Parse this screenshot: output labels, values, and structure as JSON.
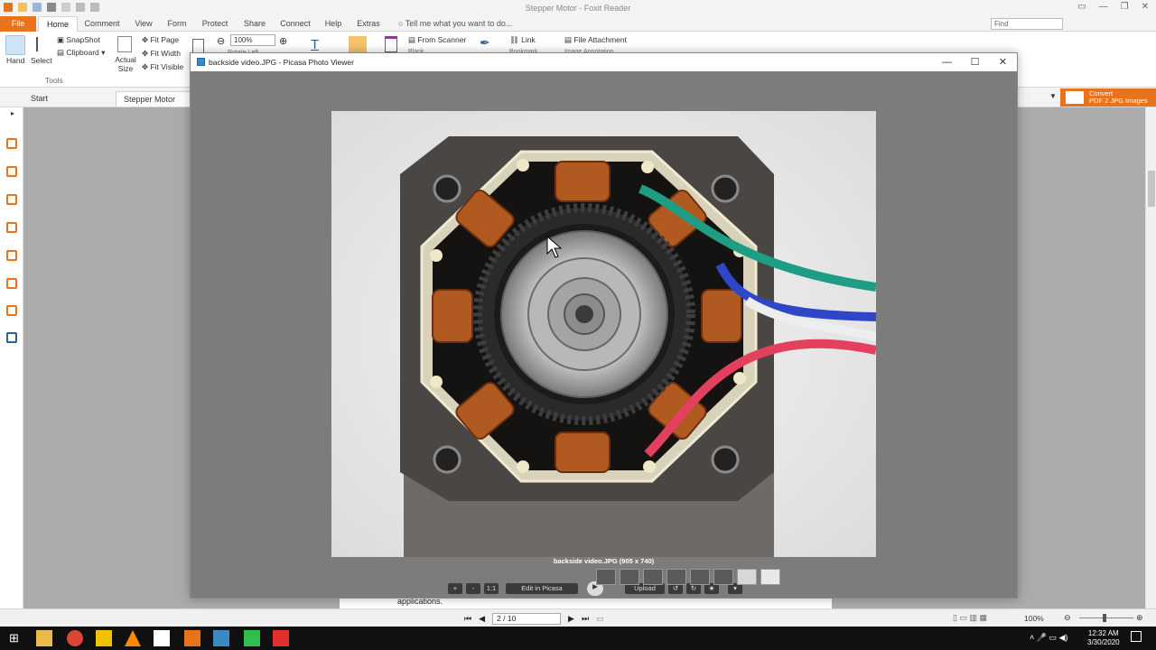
{
  "foxit": {
    "window_title": "Stepper Motor - Foxit Reader",
    "tabs": [
      "File",
      "Home",
      "Comment",
      "View",
      "Form",
      "Protect",
      "Share",
      "Connect",
      "Help",
      "Extras"
    ],
    "tell_me": "Tell me what you want to do...",
    "find_placeholder": "Find",
    "ribbon": {
      "hand": "Hand",
      "select": "Select",
      "snapshot": "SnapShot",
      "clipboard": "Clipboard",
      "tools_group": "Tools",
      "actual_size": "Actual Size",
      "fit_page": "Fit Page",
      "fit_width": "Fit Width",
      "fit_visible": "Fit Visible",
      "zoom": "100%",
      "rotate_left": "Rotate Left",
      "from_scanner": "From Scanner",
      "blank": "Blank",
      "link": "Link",
      "bookmark": "Bookmark",
      "file_attachment": "File Attachment",
      "image_annotation": "Image Annotation"
    },
    "doc_tabs": {
      "start": "Start",
      "active": "Stepper Motor"
    },
    "convert": {
      "line1": "Convert",
      "line2": "PDF 2 JPG Images"
    },
    "page_text": "applications.",
    "page_indicator": "2 / 10",
    "status_zoom": "100%"
  },
  "picasa": {
    "window_title": "backside video.JPG - Picasa Photo Viewer",
    "caption": "backside video.JPG (905 x 740)",
    "toolbar": {
      "zoom_in": "+",
      "zoom_out": "-",
      "actual": "1:1",
      "edit": "Edit in Picasa",
      "upload": "Upload"
    }
  },
  "taskbar": {
    "time": "12:32 AM",
    "date": "3/30/2020"
  },
  "colors": {
    "foxit_orange": "#e8731a",
    "picasa_bg": "#7c7c7c",
    "taskbar": "#101010"
  }
}
